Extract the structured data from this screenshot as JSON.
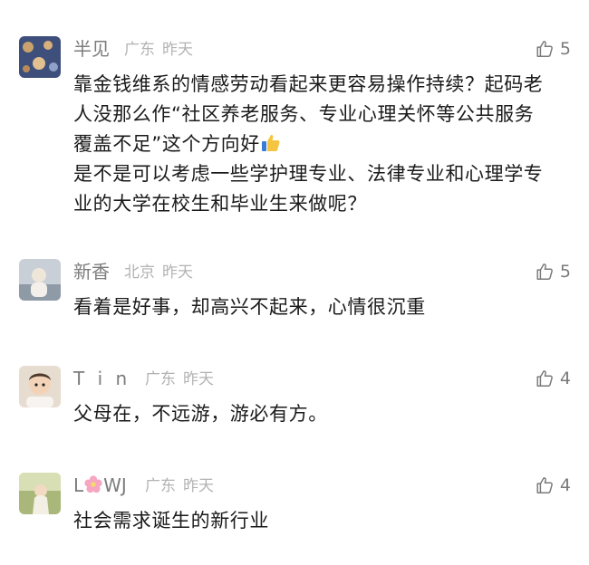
{
  "comments": [
    {
      "name": "半见",
      "region": "广东",
      "time": "昨天",
      "likes": "5",
      "lines": [
        "靠金钱维系的情感劳动看起来更容易操作持续？起码老",
        "人没那么作“社区养老服务、专业心理关怀等公共服务",
        "覆盖不足”这个方向好",
        "是不是可以考虑一些学护理专业、法律专业和心理学专",
        "业的大学在校生和毕业生来做呢？"
      ]
    },
    {
      "name": "新香",
      "region": "北京",
      "time": "昨天",
      "likes": "5",
      "lines": [
        "看着是好事，却高兴不起来，心情很沉重"
      ]
    },
    {
      "name": "T i n",
      "region": "广东",
      "time": "昨天",
      "likes": "4",
      "lines": [
        "父母在，不远游，游必有方。"
      ]
    },
    {
      "name_prefix": "L",
      "name_suffix": "WJ",
      "region": "广东",
      "time": "昨天",
      "likes": "4",
      "lines": [
        "社会需求诞生的新行业"
      ]
    }
  ],
  "icons": {
    "like": "thumbs-up-outline-icon",
    "thumb_emoji": "thumbs-up-emoji",
    "flower_emoji": "cherry-blossom-emoji"
  },
  "colors": {
    "name": "#7c7c7c",
    "meta": "#b3b3b3",
    "text": "#1a1a1a"
  }
}
